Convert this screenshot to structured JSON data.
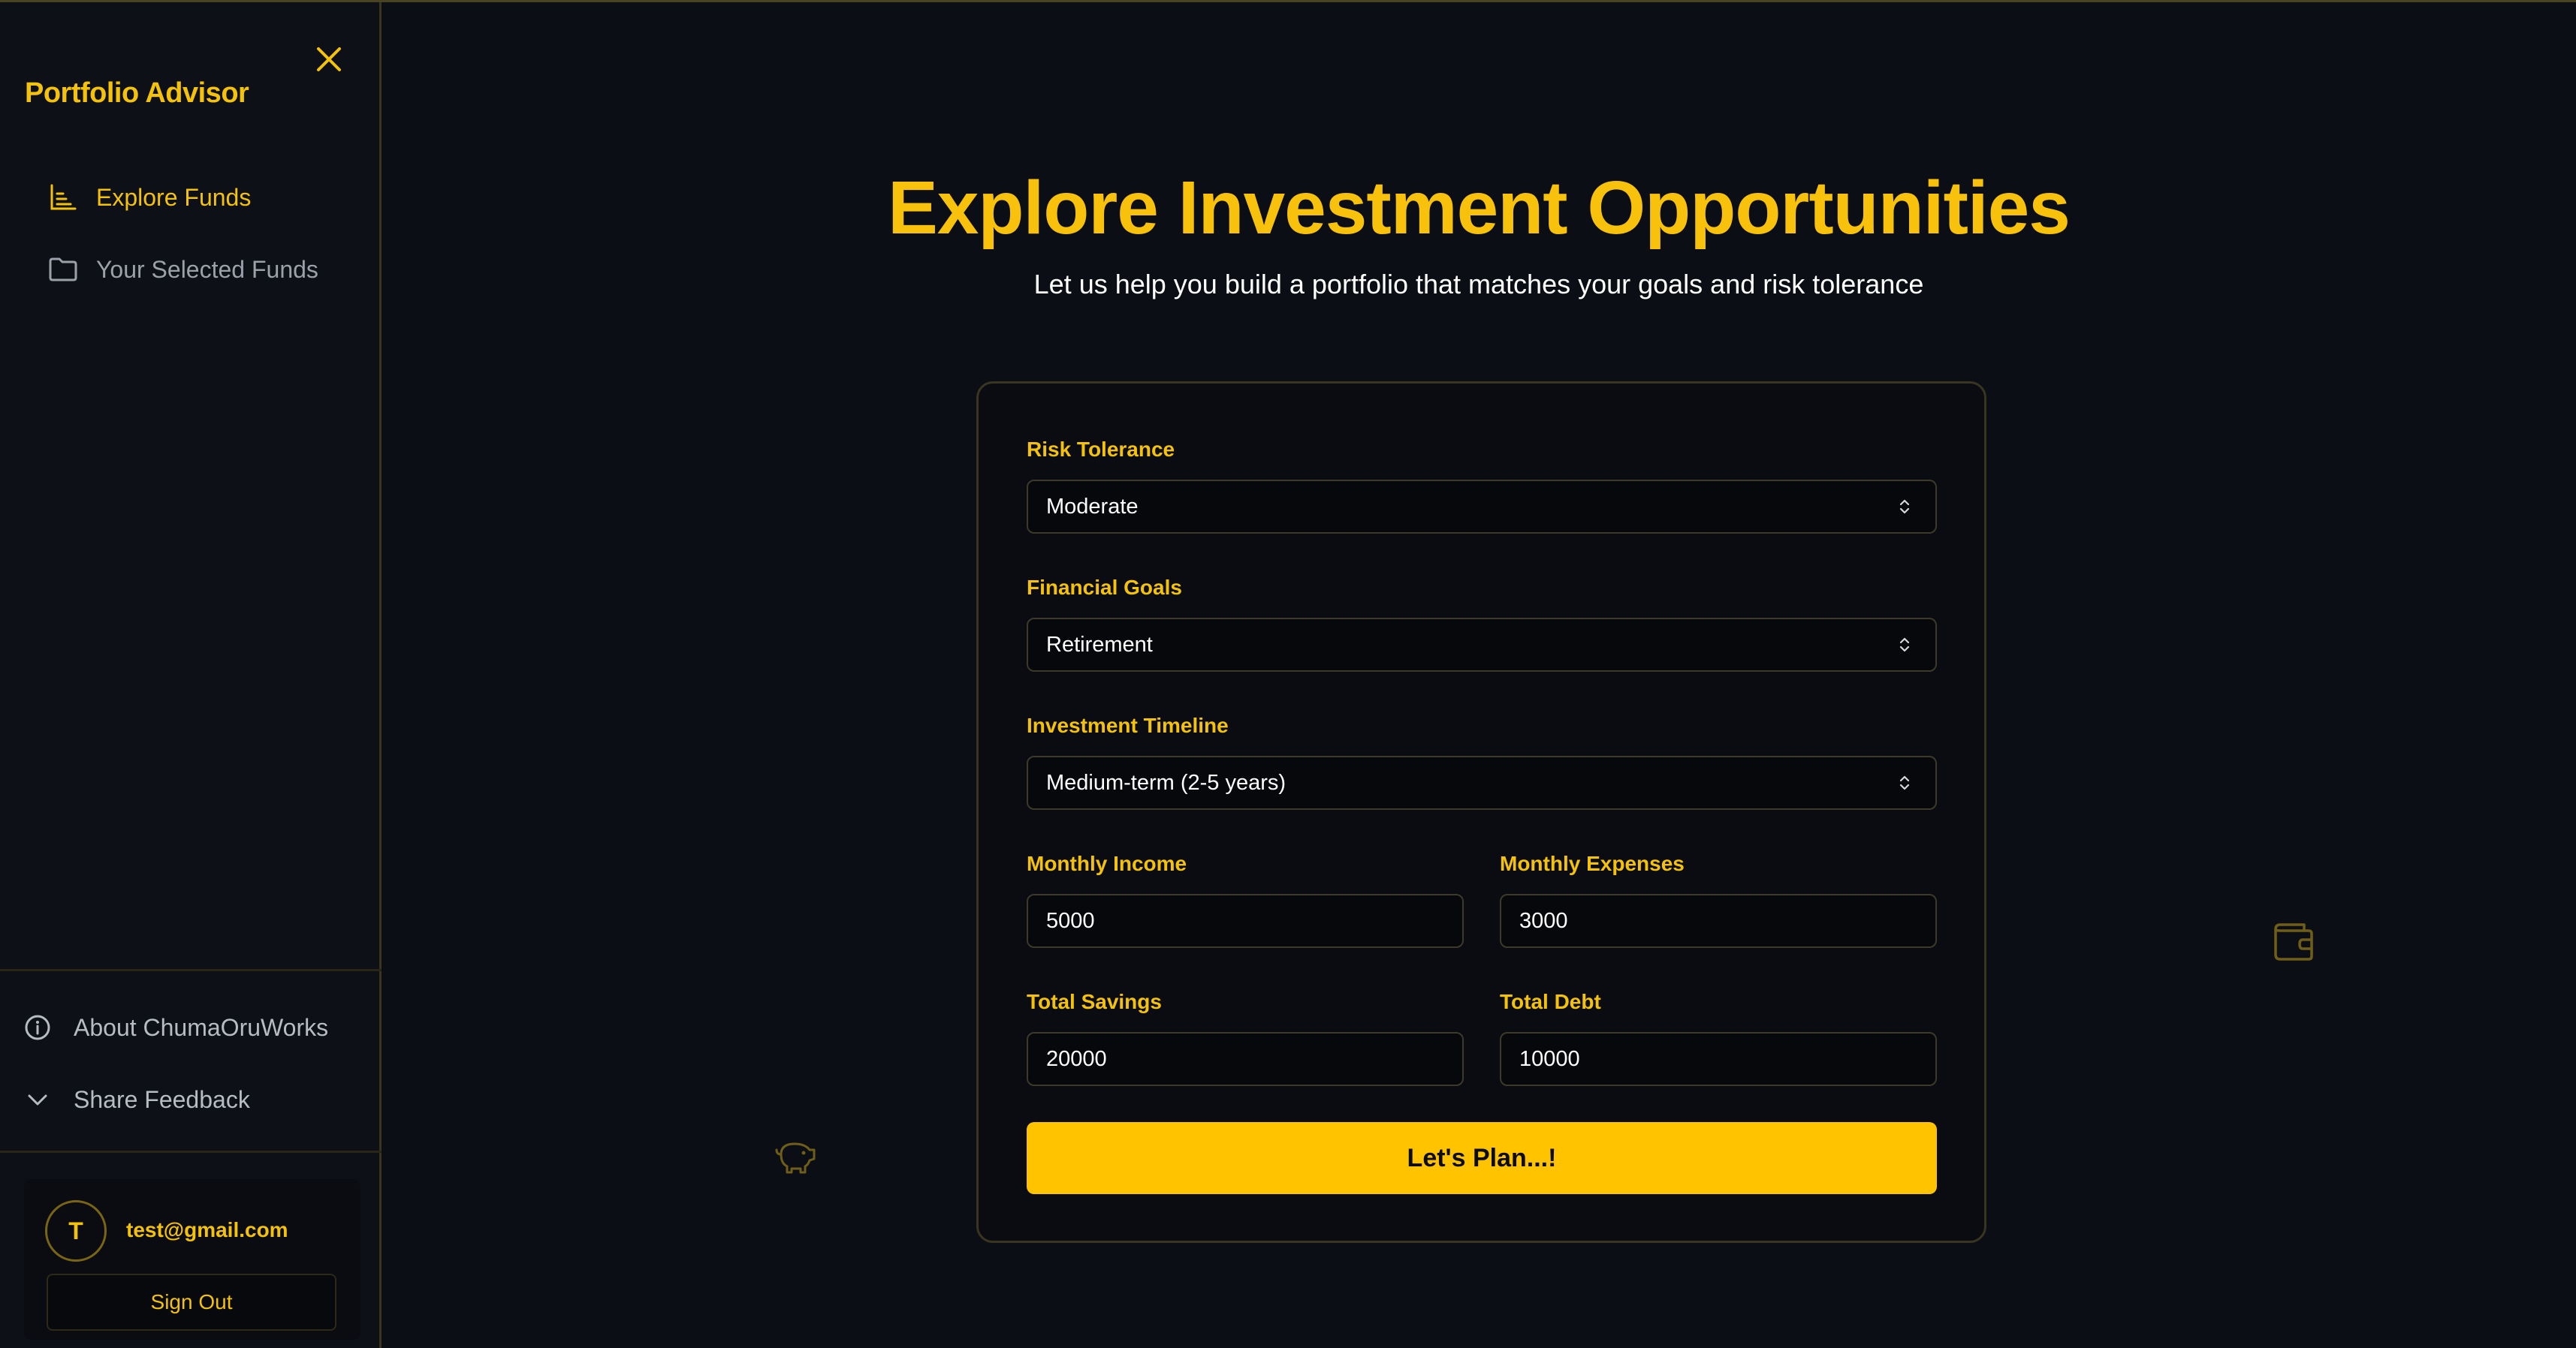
{
  "sidebar": {
    "brand": "Portfolio Advisor",
    "nav": [
      {
        "label": "Explore Funds",
        "icon": "bar-chart-icon",
        "active": true
      },
      {
        "label": "Your Selected Funds",
        "icon": "folder-icon",
        "active": false
      }
    ],
    "footer": [
      {
        "label": "About ChumaOruWorks",
        "icon": "info-icon"
      },
      {
        "label": "Share Feedback",
        "icon": "chevron-down-icon"
      }
    ],
    "user": {
      "initial": "T",
      "email": "test@gmail.com",
      "signout_label": "Sign Out"
    }
  },
  "main": {
    "title": "Explore Investment Opportunities",
    "subtitle": "Let us help you build a portfolio that matches your goals and risk tolerance"
  },
  "form": {
    "risk": {
      "label": "Risk Tolerance",
      "value": "Moderate"
    },
    "goals": {
      "label": "Financial Goals",
      "value": "Retirement"
    },
    "timeline": {
      "label": "Investment Timeline",
      "value": "Medium-term (2-5 years)"
    },
    "income": {
      "label": "Monthly Income",
      "value": "5000"
    },
    "expenses": {
      "label": "Monthly Expenses",
      "value": "3000"
    },
    "savings": {
      "label": "Total Savings",
      "value": "20000"
    },
    "debt": {
      "label": "Total Debt",
      "value": "10000"
    },
    "submit_label": "Let's Plan...!"
  },
  "colors": {
    "accent": "#f5c20b",
    "button": "#ffc300",
    "background": "#0b0e15"
  },
  "decor": [
    "piggy-bank-icon",
    "wallet-icon"
  ]
}
